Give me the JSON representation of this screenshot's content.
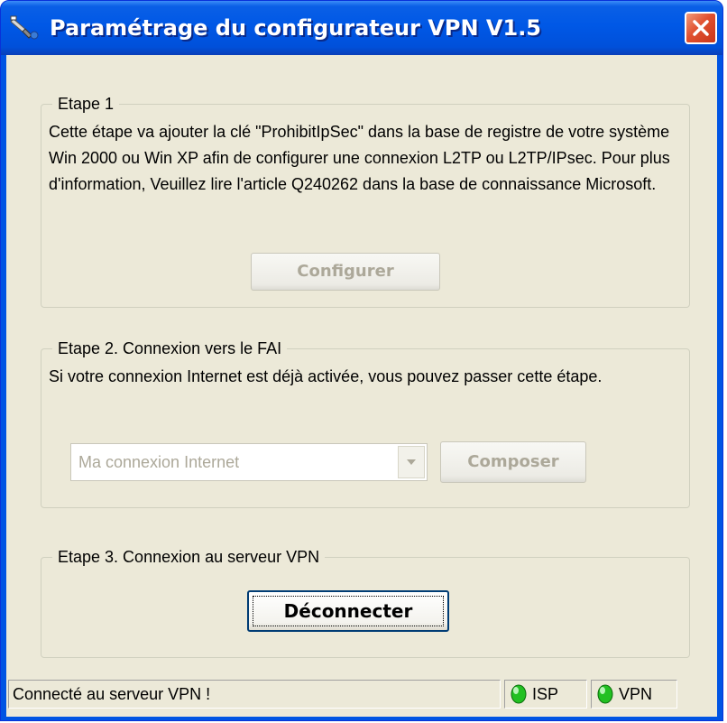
{
  "window": {
    "title": "Paramétrage du configurateur VPN V1.5",
    "close_icon": "close-x-icon"
  },
  "step1": {
    "legend": "Etape 1",
    "description": "Cette étape va ajouter la clé \"ProhibitIpSec\" dans la base de registre de votre système Win 2000 ou Win XP afin de configurer une connexion L2TP ou L2TP/IPsec. Pour plus d'information, Veuillez lire l'article Q240262 dans la base de connaissance Microsoft.",
    "button_label": "Configurer",
    "button_enabled": false
  },
  "step2": {
    "legend": "Etape 2. Connexion vers le FAI",
    "description": "Si votre connexion Internet est déjà activée, vous pouvez passer cette étape.",
    "connection_select": {
      "value": "Ma connexion Internet",
      "enabled": false
    },
    "button_label": "Composer",
    "button_enabled": false
  },
  "step3": {
    "legend": "Etape 3. Connexion au serveur VPN",
    "button_label": "Déconnecter",
    "button_enabled": true
  },
  "statusbar": {
    "message": "Connecté au serveur VPN !",
    "indicators": [
      {
        "label": "ISP",
        "icon": "green-led-icon",
        "color": "#22c022"
      },
      {
        "label": "VPN",
        "icon": "green-led-icon",
        "color": "#22c022"
      }
    ]
  },
  "colors": {
    "titlebar_blue": "#0054e3",
    "dialog_face": "#ece9d8",
    "disabled_text": "#aca899",
    "close_red": "#e0502f"
  }
}
